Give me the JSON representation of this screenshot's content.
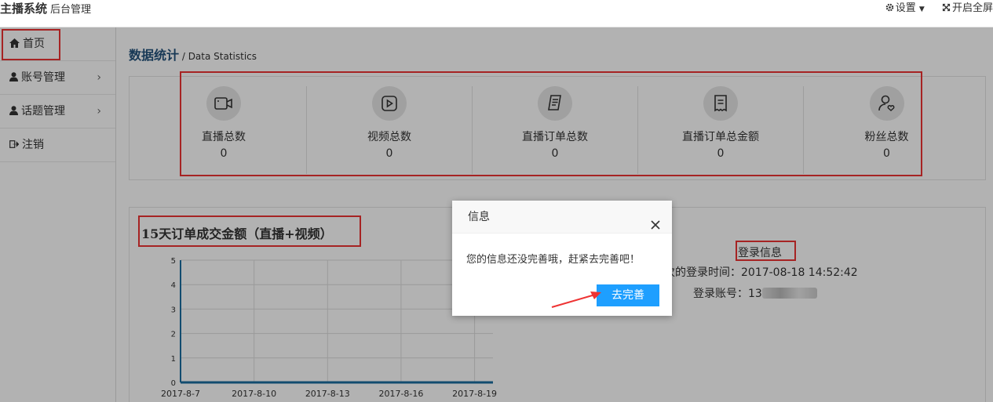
{
  "header": {
    "brand": "主播系统",
    "brand_sub": "后台管理",
    "settings_label": "设置",
    "fullscreen_label": "开启全屏"
  },
  "sidebar": {
    "items": [
      {
        "label": "首页",
        "icon": "home-icon"
      },
      {
        "label": "账号管理",
        "icon": "user-icon"
      },
      {
        "label": "话题管理",
        "icon": "user-icon"
      },
      {
        "label": "注销",
        "icon": "logout-icon"
      }
    ]
  },
  "breadcrumb": {
    "title": "数据统计",
    "separator": " / ",
    "subtitle": "Data Statistics"
  },
  "stats": [
    {
      "label": "直播总数",
      "value": "0",
      "icon": "video-camera-icon"
    },
    {
      "label": "视频总数",
      "value": "0",
      "icon": "play-icon"
    },
    {
      "label": "直播订单总数",
      "value": "0",
      "icon": "order-list-icon"
    },
    {
      "label": "直播订单总金额",
      "value": "0",
      "icon": "receipt-icon"
    },
    {
      "label": "粉丝总数",
      "value": "0",
      "icon": "fans-icon"
    }
  ],
  "chart_data": {
    "type": "line",
    "title": "15天订单成交金额（直播+视频）",
    "categories": [
      "2017-8-7",
      "2017-8-10",
      "2017-8-13",
      "2017-8-16",
      "2017-8-19"
    ],
    "values": [
      0,
      0,
      0,
      0,
      0
    ],
    "ylim": [
      0,
      5
    ],
    "yticks": [
      "0",
      "1",
      "2",
      "3",
      "4",
      "5"
    ],
    "grid": true,
    "color": "#1a6ea0"
  },
  "login": {
    "title": "登录信息",
    "time_label": "次的登录时间：2017-08-18 14:52:42",
    "account_label": "登录账号：13"
  },
  "dialog": {
    "title": "信息",
    "message": "您的信息还没完善哦，赶紧去完善吧！",
    "button": "去完善"
  }
}
